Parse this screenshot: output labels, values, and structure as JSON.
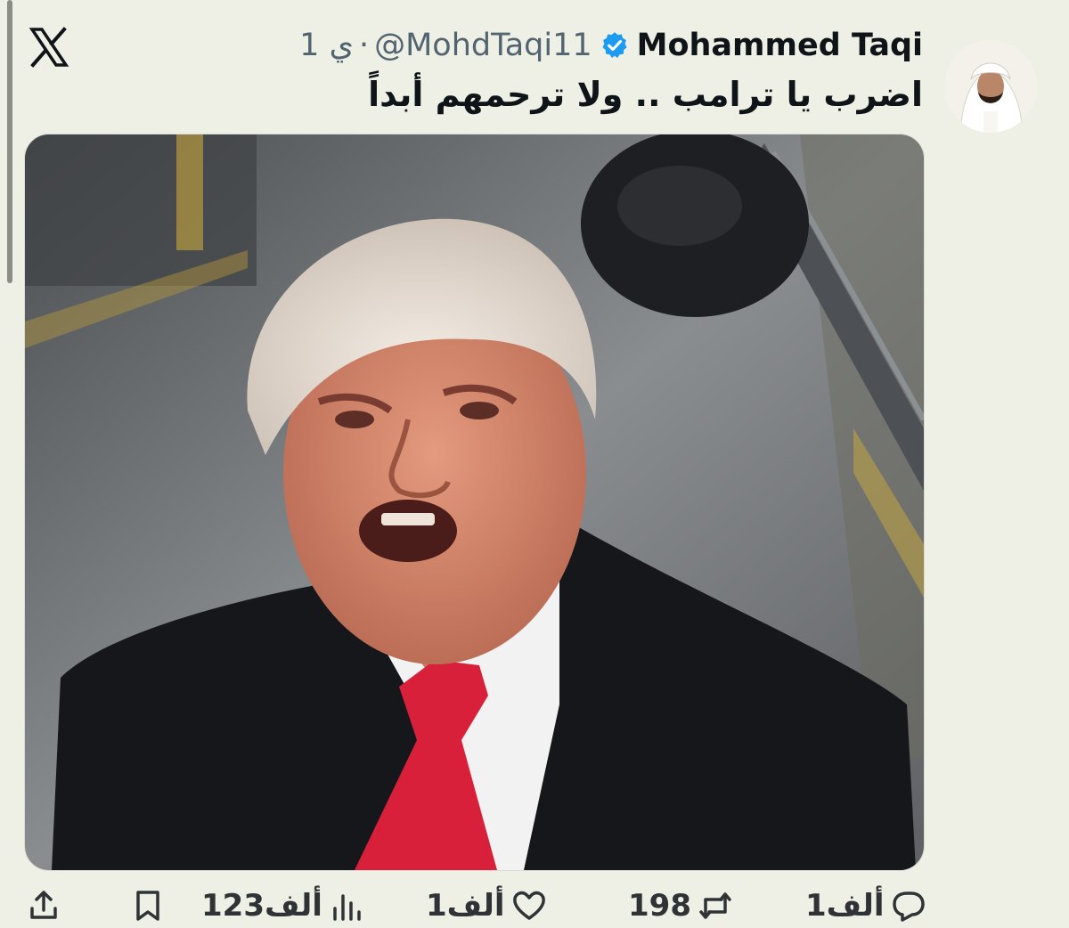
{
  "tweet": {
    "time": "1 ي",
    "separator": "·",
    "handle": "@MohdTaqi11",
    "name": "Mohammed Taqi",
    "text": "اضرب يا ترامب .. ولا ترحمهم أبداً"
  },
  "actions": {
    "replies": "1ألف",
    "retweets": "198",
    "likes": "1ألف",
    "views": "123ألف"
  },
  "icons": {
    "logo": "x-logo-icon",
    "verified": "verified-badge-icon",
    "reply": "reply-icon",
    "retweet": "retweet-icon",
    "like": "heart-icon",
    "views": "views-icon",
    "bookmark": "bookmark-icon",
    "share": "share-icon"
  },
  "colors": {
    "background": "#eef0e6",
    "verified": "#1d9bf0",
    "tie": "#d8203a"
  }
}
